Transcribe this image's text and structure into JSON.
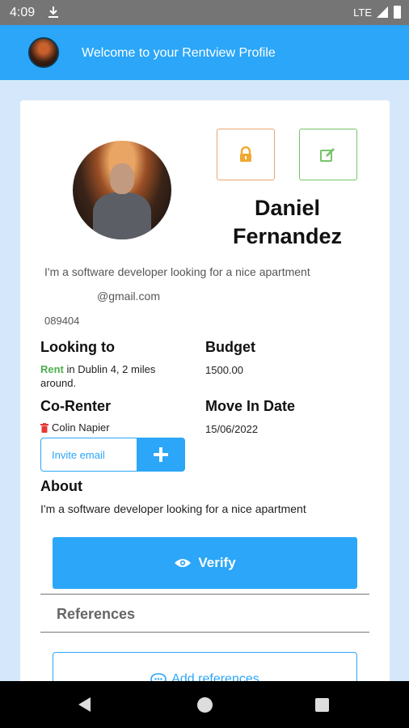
{
  "status_bar": {
    "time": "4:09",
    "network": "LTE"
  },
  "app_bar": {
    "title": "Welcome to your Rentview Profile"
  },
  "profile": {
    "name": "Daniel Fernandez",
    "tagline": "I'm a software developer looking for a nice apartment",
    "email": "@gmail.com",
    "phone": "089404"
  },
  "looking_to": {
    "label": "Looking to",
    "mode": "Rent",
    "detail": " in Dublin 4, 2 miles around."
  },
  "budget": {
    "label": "Budget",
    "value": "1500.00"
  },
  "co_renter": {
    "label": "Co-Renter",
    "name": "Colin Napier",
    "invite_placeholder": "Invite email",
    "add_label": "+"
  },
  "move_in": {
    "label": "Move In Date",
    "value": "15/06/2022"
  },
  "about": {
    "label": "About",
    "text": "I'm a software developer looking for a nice apartment"
  },
  "verify": {
    "label": "Verify"
  },
  "references": {
    "label": "References",
    "add_label": "Add references"
  },
  "colors": {
    "primary": "#2ba6f8",
    "rent_green": "#4caf50",
    "lock_orange": "#f0a830",
    "edit_green": "#78c46a",
    "trash_red": "#e53935"
  },
  "icons": [
    "download-icon",
    "signal-icon",
    "battery-icon",
    "lock-icon",
    "edit-icon",
    "trash-icon",
    "eye-icon",
    "chat-icon",
    "back-icon",
    "home-icon",
    "recents-icon"
  ]
}
